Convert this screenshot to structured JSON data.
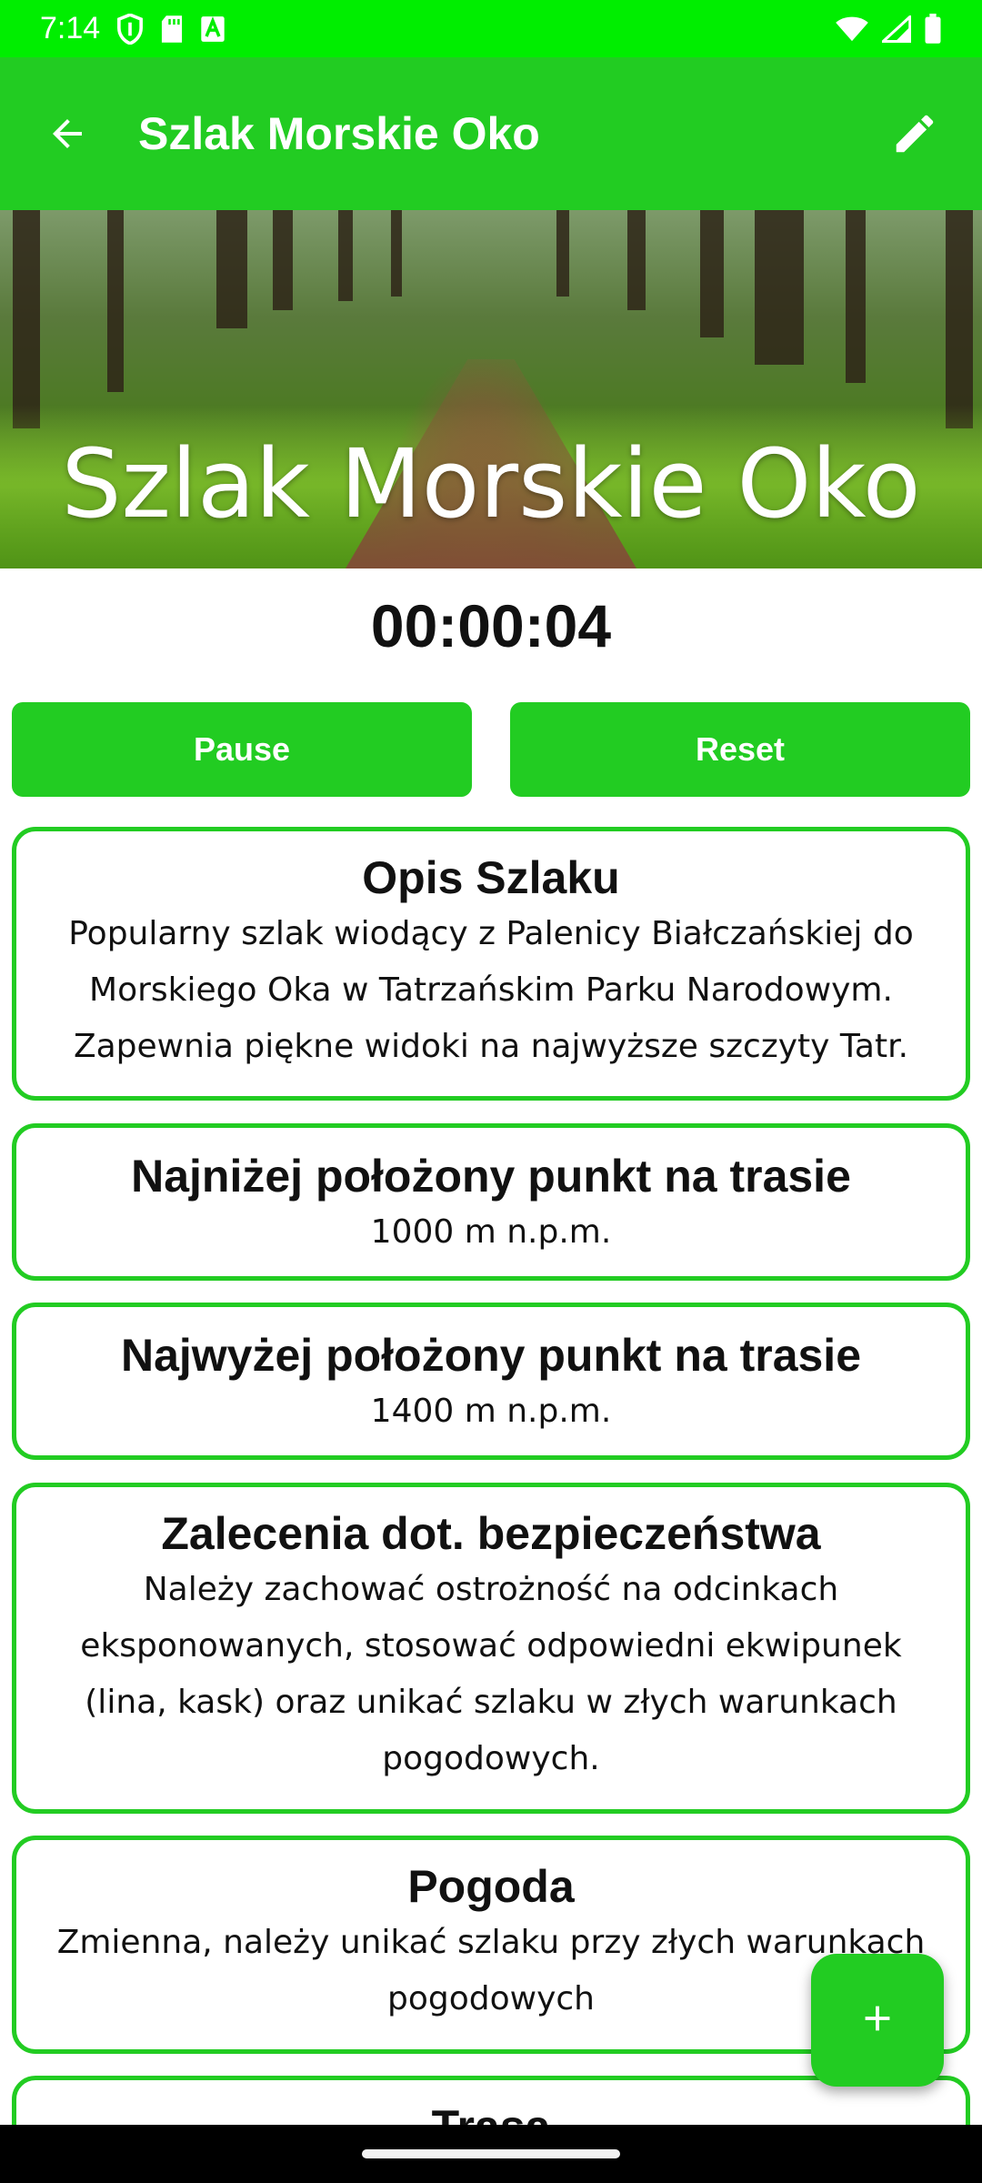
{
  "status_bar": {
    "time": "7:14",
    "icons_left": [
      "shield-icon",
      "sd-card-icon",
      "notification-a-icon"
    ],
    "icons_right": [
      "wifi-icon",
      "signal-icon",
      "battery-icon"
    ]
  },
  "app_bar": {
    "title": "Szlak Morskie Oko",
    "back_icon": "arrow-back-icon",
    "edit_icon": "edit-icon",
    "color": "#22cc22"
  },
  "hero": {
    "title": "Szlak Morskie Oko"
  },
  "timer": {
    "value": "00:00:04"
  },
  "buttons": {
    "pause_label": "Pause",
    "reset_label": "Reset"
  },
  "cards": [
    {
      "heading": "Opis Szlaku",
      "body": "Popularny szlak wiodący z Palenicy Białczańskiej do Morskiego Oka w Tatrzańskim Parku Narodowym. Zapewnia piękne widoki na najwyższe szczyty Tatr."
    },
    {
      "heading": "Najniżej położony punkt na trasie",
      "body": "1000 m n.p.m."
    },
    {
      "heading": "Najwyżej położony punkt na trasie",
      "body": "1400 m n.p.m."
    },
    {
      "heading": "Zalecenia dot. bezpieczeństwa",
      "body": "Należy zachować ostrożność na odcinkach eksponowanych, stosować odpowiedni ekwipunek (lina, kask) oraz unikać szlaku w złych warunkach pogodowych."
    },
    {
      "heading": "Pogoda",
      "body": "Zmienna, należy unikać szlaku przy złych warunkach pogodowych"
    },
    {
      "heading": "Trasa",
      "body": ""
    }
  ],
  "fab": {
    "icon": "plus-icon"
  },
  "colors": {
    "status_bar": "#00ee00",
    "accent": "#22cc22"
  }
}
